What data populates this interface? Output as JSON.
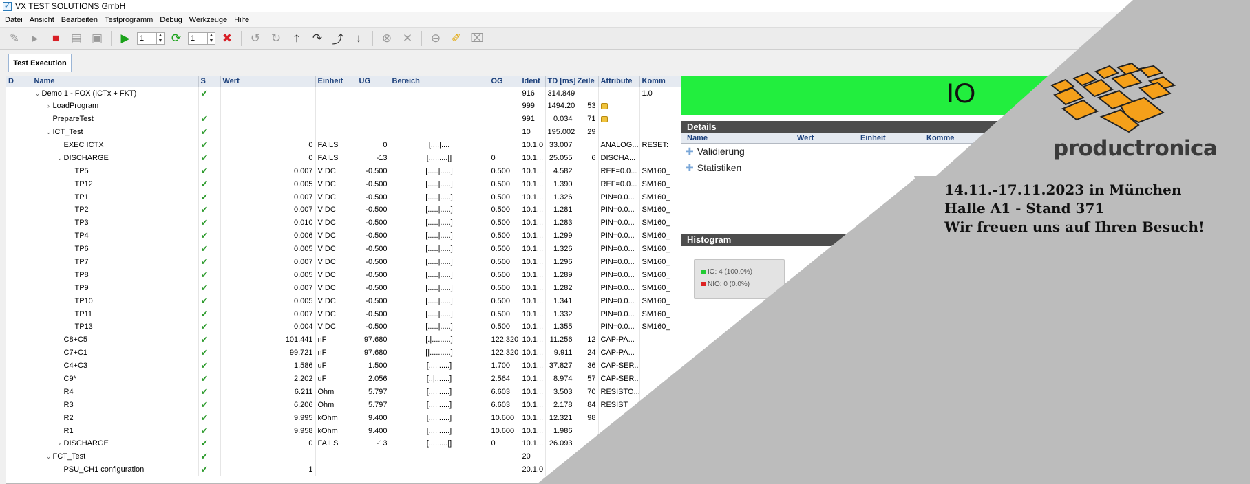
{
  "window": {
    "title": "VX TEST SOLUTIONS GmbH"
  },
  "menu": [
    "Datei",
    "Ansicht",
    "Bearbeiten",
    "Testprogramm",
    "Debug",
    "Werkzeuge",
    "Hilfe"
  ],
  "toolbar": {
    "repeat_count": "1",
    "loop_count": "1"
  },
  "tabs": {
    "active": "Test Execution"
  },
  "tree": {
    "columns": [
      "D",
      "Name",
      "S",
      "Wert",
      "Einheit",
      "UG",
      "Bereich",
      "OG",
      "Ident",
      "TD [ms]",
      "Zeile",
      "Attribute",
      "Komm"
    ],
    "rows": [
      {
        "level": 1,
        "exp": "down",
        "name": "Demo 1 - FOX (ICTx + FKT)",
        "ok": true,
        "wert": "",
        "einheit": "",
        "ug": "",
        "bereich": "",
        "og": "",
        "ident": "916",
        "td": "314.849",
        "zeile": "",
        "attr": "",
        "komm": "1.0",
        "lock": false
      },
      {
        "level": 2,
        "exp": "right",
        "name": "LoadProgram",
        "ok": false,
        "wert": "",
        "einheit": "",
        "ug": "",
        "bereich": "",
        "og": "",
        "ident": "999",
        "td": "1494.204",
        "zeile": "53",
        "attr": "",
        "komm": "",
        "lock": true
      },
      {
        "level": 2,
        "exp": "",
        "name": "PrepareTest",
        "ok": true,
        "wert": "",
        "einheit": "",
        "ug": "",
        "bereich": "",
        "og": "",
        "ident": "991",
        "td": "0.034",
        "zeile": "71",
        "attr": "",
        "komm": "",
        "lock": true
      },
      {
        "level": 2,
        "exp": "down",
        "name": "ICT_Test",
        "ok": true,
        "wert": "",
        "einheit": "",
        "ug": "",
        "bereich": "",
        "og": "",
        "ident": "10",
        "td": "195.002",
        "zeile": "29",
        "attr": "",
        "komm": "",
        "lock": false
      },
      {
        "level": 3,
        "exp": "",
        "name": "EXEC ICTX",
        "ok": true,
        "wert": "0",
        "einheit": "FAILS",
        "ug": "0",
        "bereich": "[....|....",
        "og": "",
        "ident": "10.1.0",
        "td": "33.007",
        "zeile": "",
        "attr": "ANALOG...",
        "komm": "RESET:",
        "lock": false
      },
      {
        "level": 3,
        "exp": "down",
        "name": "DISCHARGE",
        "ok": true,
        "wert": "0",
        "einheit": "FAILS",
        "ug": "-13",
        "bereich": "[.........|]",
        "og": "0",
        "ident": "10.1...",
        "td": "25.055",
        "zeile": "6",
        "attr": "DISCHA...",
        "komm": "",
        "lock": false
      },
      {
        "level": 4,
        "exp": "",
        "name": "TP5",
        "ok": true,
        "wert": "0.007",
        "einheit": "V DC",
        "ug": "-0.500",
        "bereich": "[.....|.....]",
        "og": "0.500",
        "ident": "10.1...",
        "td": "4.582",
        "zeile": "",
        "attr": "REF=0.0...",
        "komm": "SM160_",
        "lock": false
      },
      {
        "level": 4,
        "exp": "",
        "name": "TP12",
        "ok": true,
        "wert": "0.005",
        "einheit": "V DC",
        "ug": "-0.500",
        "bereich": "[.....|.....]",
        "og": "0.500",
        "ident": "10.1...",
        "td": "1.390",
        "zeile": "",
        "attr": "REF=0.0...",
        "komm": "SM160_",
        "lock": false
      },
      {
        "level": 4,
        "exp": "",
        "name": "TP1",
        "ok": true,
        "wert": "0.007",
        "einheit": "V DC",
        "ug": "-0.500",
        "bereich": "[.....|.....]",
        "og": "0.500",
        "ident": "10.1...",
        "td": "1.326",
        "zeile": "",
        "attr": "PIN=0.0...",
        "komm": "SM160_",
        "lock": false
      },
      {
        "level": 4,
        "exp": "",
        "name": "TP2",
        "ok": true,
        "wert": "0.007",
        "einheit": "V DC",
        "ug": "-0.500",
        "bereich": "[.....|.....]",
        "og": "0.500",
        "ident": "10.1...",
        "td": "1.281",
        "zeile": "",
        "attr": "PIN=0.0...",
        "komm": "SM160_",
        "lock": false
      },
      {
        "level": 4,
        "exp": "",
        "name": "TP3",
        "ok": true,
        "wert": "0.010",
        "einheit": "V DC",
        "ug": "-0.500",
        "bereich": "[.....|.....]",
        "og": "0.500",
        "ident": "10.1...",
        "td": "1.283",
        "zeile": "",
        "attr": "PIN=0.0...",
        "komm": "SM160_",
        "lock": false
      },
      {
        "level": 4,
        "exp": "",
        "name": "TP4",
        "ok": true,
        "wert": "0.006",
        "einheit": "V DC",
        "ug": "-0.500",
        "bereich": "[.....|.....]",
        "og": "0.500",
        "ident": "10.1...",
        "td": "1.299",
        "zeile": "",
        "attr": "PIN=0.0...",
        "komm": "SM160_",
        "lock": false
      },
      {
        "level": 4,
        "exp": "",
        "name": "TP6",
        "ok": true,
        "wert": "0.005",
        "einheit": "V DC",
        "ug": "-0.500",
        "bereich": "[.....|.....]",
        "og": "0.500",
        "ident": "10.1...",
        "td": "1.326",
        "zeile": "",
        "attr": "PIN=0.0...",
        "komm": "SM160_",
        "lock": false
      },
      {
        "level": 4,
        "exp": "",
        "name": "TP7",
        "ok": true,
        "wert": "0.007",
        "einheit": "V DC",
        "ug": "-0.500",
        "bereich": "[.....|.....]",
        "og": "0.500",
        "ident": "10.1...",
        "td": "1.296",
        "zeile": "",
        "attr": "PIN=0.0...",
        "komm": "SM160_",
        "lock": false
      },
      {
        "level": 4,
        "exp": "",
        "name": "TP8",
        "ok": true,
        "wert": "0.005",
        "einheit": "V DC",
        "ug": "-0.500",
        "bereich": "[.....|.....]",
        "og": "0.500",
        "ident": "10.1...",
        "td": "1.289",
        "zeile": "",
        "attr": "PIN=0.0...",
        "komm": "SM160_",
        "lock": false
      },
      {
        "level": 4,
        "exp": "",
        "name": "TP9",
        "ok": true,
        "wert": "0.007",
        "einheit": "V DC",
        "ug": "-0.500",
        "bereich": "[.....|.....]",
        "og": "0.500",
        "ident": "10.1...",
        "td": "1.282",
        "zeile": "",
        "attr": "PIN=0.0...",
        "komm": "SM160_",
        "lock": false
      },
      {
        "level": 4,
        "exp": "",
        "name": "TP10",
        "ok": true,
        "wert": "0.005",
        "einheit": "V DC",
        "ug": "-0.500",
        "bereich": "[.....|.....]",
        "og": "0.500",
        "ident": "10.1...",
        "td": "1.341",
        "zeile": "",
        "attr": "PIN=0.0...",
        "komm": "SM160_",
        "lock": false
      },
      {
        "level": 4,
        "exp": "",
        "name": "TP11",
        "ok": true,
        "wert": "0.007",
        "einheit": "V DC",
        "ug": "-0.500",
        "bereich": "[.....|.....]",
        "og": "0.500",
        "ident": "10.1...",
        "td": "1.332",
        "zeile": "",
        "attr": "PIN=0.0...",
        "komm": "SM160_",
        "lock": false
      },
      {
        "level": 4,
        "exp": "",
        "name": "TP13",
        "ok": true,
        "wert": "0.004",
        "einheit": "V DC",
        "ug": "-0.500",
        "bereich": "[.....|.....]",
        "og": "0.500",
        "ident": "10.1...",
        "td": "1.355",
        "zeile": "",
        "attr": "PIN=0.0...",
        "komm": "SM160_",
        "lock": false
      },
      {
        "level": 3,
        "exp": "",
        "name": "C8+C5",
        "ok": true,
        "wert": "101.441",
        "einheit": "nF",
        "ug": "97.680",
        "bereich": "[.|.........]",
        "og": "122.320",
        "ident": "10.1...",
        "td": "11.256",
        "zeile": "12",
        "attr": "CAP-PA...",
        "komm": "",
        "lock": false
      },
      {
        "level": 3,
        "exp": "",
        "name": "C7+C1",
        "ok": true,
        "wert": "99.721",
        "einheit": "nF",
        "ug": "97.680",
        "bereich": "[|..........]",
        "og": "122.320",
        "ident": "10.1...",
        "td": "9.911",
        "zeile": "24",
        "attr": "CAP-PA...",
        "komm": "",
        "lock": false
      },
      {
        "level": 3,
        "exp": "",
        "name": "C4+C3",
        "ok": true,
        "wert": "1.586",
        "einheit": "uF",
        "ug": "1.500",
        "bereich": "[....|.....]",
        "og": "1.700",
        "ident": "10.1...",
        "td": "37.827",
        "zeile": "36",
        "attr": "CAP-SER...",
        "komm": "",
        "lock": false
      },
      {
        "level": 3,
        "exp": "",
        "name": "C9*",
        "ok": true,
        "wert": "2.202",
        "einheit": "uF",
        "ug": "2.056",
        "bereich": "[..|.......]",
        "og": "2.564",
        "ident": "10.1...",
        "td": "8.974",
        "zeile": "57",
        "attr": "CAP-SER...",
        "komm": "",
        "lock": false
      },
      {
        "level": 3,
        "exp": "",
        "name": "R4",
        "ok": true,
        "wert": "6.211",
        "einheit": "Ohm",
        "ug": "5.797",
        "bereich": "[....|.....]",
        "og": "6.603",
        "ident": "10.1...",
        "td": "3.503",
        "zeile": "70",
        "attr": "RESISTO...",
        "komm": "",
        "lock": false
      },
      {
        "level": 3,
        "exp": "",
        "name": "R3",
        "ok": true,
        "wert": "6.206",
        "einheit": "Ohm",
        "ug": "5.797",
        "bereich": "[....|.....]",
        "og": "6.603",
        "ident": "10.1...",
        "td": "2.178",
        "zeile": "84",
        "attr": "RESIST",
        "komm": "",
        "lock": false
      },
      {
        "level": 3,
        "exp": "",
        "name": "R2",
        "ok": true,
        "wert": "9.995",
        "einheit": "kOhm",
        "ug": "9.400",
        "bereich": "[....|.....]",
        "og": "10.600",
        "ident": "10.1...",
        "td": "12.321",
        "zeile": "98",
        "attr": "",
        "komm": "",
        "lock": false
      },
      {
        "level": 3,
        "exp": "",
        "name": "R1",
        "ok": true,
        "wert": "9.958",
        "einheit": "kOhm",
        "ug": "9.400",
        "bereich": "[....|.....]",
        "og": "10.600",
        "ident": "10.1...",
        "td": "1.986",
        "zeile": "",
        "attr": "",
        "komm": "",
        "lock": false
      },
      {
        "level": 3,
        "exp": "right",
        "name": "DISCHARGE",
        "ok": true,
        "wert": "0",
        "einheit": "FAILS",
        "ug": "-13",
        "bereich": "[.........|]",
        "og": "0",
        "ident": "10.1...",
        "td": "26.093",
        "zeile": "",
        "attr": "",
        "komm": "",
        "lock": false
      },
      {
        "level": 2,
        "exp": "down",
        "name": "FCT_Test",
        "ok": true,
        "wert": "",
        "einheit": "",
        "ug": "",
        "bereich": "",
        "og": "",
        "ident": "20",
        "td": "",
        "zeile": "",
        "attr": "",
        "komm": "",
        "lock": false
      },
      {
        "level": 3,
        "exp": "",
        "name": "PSU_CH1 configuration",
        "ok": true,
        "wert": "1",
        "einheit": "",
        "ug": "",
        "bereich": "",
        "og": "",
        "ident": "20.1.0",
        "td": "",
        "zeile": "",
        "attr": "",
        "komm": "",
        "lock": false
      }
    ]
  },
  "result": {
    "status": "IO"
  },
  "details": {
    "header": "Details",
    "columns": [
      "Name",
      "Wert",
      "Einheit",
      "Komme"
    ],
    "items": [
      "Validierung",
      "Statistiken"
    ]
  },
  "histogram": {
    "header": "Histogram",
    "legend_io": "IO: 4 (100.0%)",
    "legend_nio": "NIO: 0 (0.0%)",
    "io_color": "#22cc33",
    "nio_color": "#dd2222"
  },
  "promo": {
    "brand": "productronica",
    "line1": "14.11.-17.11.2023 in München",
    "line2": "Halle A1 - Stand 371",
    "line3": "Wir freuen uns auf Ihren Besuch!",
    "accent": "#f5a01a",
    "overlay_gray": "#bcbcbc"
  },
  "colors": {
    "io_green": "#22ee3e",
    "check_green": "#2b9a2b"
  }
}
